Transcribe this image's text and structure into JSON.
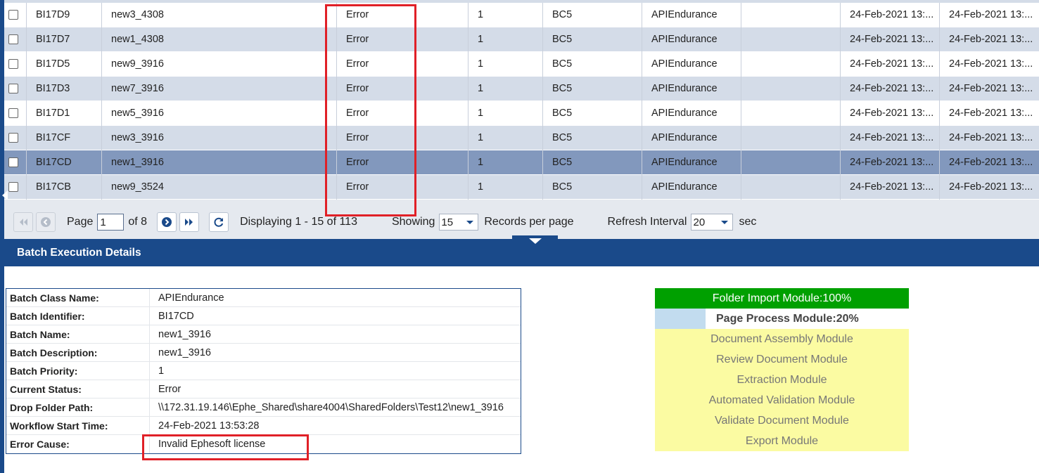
{
  "grid": {
    "rows": [
      {
        "id": "BI17D9",
        "name": "new3_4308",
        "status": "Error",
        "priority": "1",
        "batch_class": "BC5",
        "class_desc": "APIEndurance",
        "extra": "",
        "date1": "24-Feb-2021 13:...",
        "date2": "24-Feb-2021 13:...",
        "selected": false
      },
      {
        "id": "BI17D7",
        "name": "new1_4308",
        "status": "Error",
        "priority": "1",
        "batch_class": "BC5",
        "class_desc": "APIEndurance",
        "extra": "",
        "date1": "24-Feb-2021 13:...",
        "date2": "24-Feb-2021 13:...",
        "selected": false
      },
      {
        "id": "BI17D5",
        "name": "new9_3916",
        "status": "Error",
        "priority": "1",
        "batch_class": "BC5",
        "class_desc": "APIEndurance",
        "extra": "",
        "date1": "24-Feb-2021 13:...",
        "date2": "24-Feb-2021 13:...",
        "selected": false
      },
      {
        "id": "BI17D3",
        "name": "new7_3916",
        "status": "Error",
        "priority": "1",
        "batch_class": "BC5",
        "class_desc": "APIEndurance",
        "extra": "",
        "date1": "24-Feb-2021 13:...",
        "date2": "24-Feb-2021 13:...",
        "selected": false
      },
      {
        "id": "BI17D1",
        "name": "new5_3916",
        "status": "Error",
        "priority": "1",
        "batch_class": "BC5",
        "class_desc": "APIEndurance",
        "extra": "",
        "date1": "24-Feb-2021 13:...",
        "date2": "24-Feb-2021 13:...",
        "selected": false
      },
      {
        "id": "BI17CF",
        "name": "new3_3916",
        "status": "Error",
        "priority": "1",
        "batch_class": "BC5",
        "class_desc": "APIEndurance",
        "extra": "",
        "date1": "24-Feb-2021 13:...",
        "date2": "24-Feb-2021 13:...",
        "selected": false
      },
      {
        "id": "BI17CD",
        "name": "new1_3916",
        "status": "Error",
        "priority": "1",
        "batch_class": "BC5",
        "class_desc": "APIEndurance",
        "extra": "",
        "date1": "24-Feb-2021 13:...",
        "date2": "24-Feb-2021 13:...",
        "selected": true
      },
      {
        "id": "BI17CB",
        "name": "new9_3524",
        "status": "Error",
        "priority": "1",
        "batch_class": "BC5",
        "class_desc": "APIEndurance",
        "extra": "",
        "date1": "24-Feb-2021 13:...",
        "date2": "24-Feb-2021 13:...",
        "selected": false
      }
    ]
  },
  "pager": {
    "page_label": "Page",
    "page_value": "1",
    "of_label": "of 8",
    "displaying": "Displaying 1 - 15 of 113",
    "showing_label": "Showing",
    "showing_value": "15",
    "records_label": "Records per page",
    "refresh_label": "Refresh Interval",
    "refresh_value": "20",
    "sec_label": "sec"
  },
  "section": {
    "title": "Batch Execution Details"
  },
  "details": [
    {
      "label": "Batch Class Name:",
      "value": "APIEndurance"
    },
    {
      "label": "Batch Identifier:",
      "value": "BI17CD"
    },
    {
      "label": "Batch Name:",
      "value": "new1_3916"
    },
    {
      "label": "Batch Description:",
      "value": "new1_3916"
    },
    {
      "label": "Batch Priority:",
      "value": "1"
    },
    {
      "label": "Current Status:",
      "value": "Error"
    },
    {
      "label": "Drop Folder Path:",
      "value": "\\\\172.31.19.146\\Ephe_Shared\\share4004\\SharedFolders\\Test12\\new1_3916"
    },
    {
      "label": "Workflow Start Time:",
      "value": "24-Feb-2021 13:53:28"
    },
    {
      "label": "Error Cause:",
      "value": "Invalid Ephesoft license"
    }
  ],
  "modules": [
    {
      "label": "Folder Import Module:100%",
      "state": "done",
      "progress": 1.0
    },
    {
      "label": "Page Process Module:20%",
      "state": "partial",
      "progress": 0.2
    },
    {
      "label": "Document Assembly Module",
      "state": "pending"
    },
    {
      "label": "Review Document Module",
      "state": "pending"
    },
    {
      "label": "Extraction Module",
      "state": "pending"
    },
    {
      "label": "Automated Validation Module",
      "state": "pending"
    },
    {
      "label": "Validate Document Module",
      "state": "pending"
    },
    {
      "label": "Export Module",
      "state": "pending"
    }
  ],
  "colors": {
    "header_blue": "#1a4a8a",
    "row_alt": "#d4dce8",
    "row_selected": "#8298bd",
    "module_done": "#00a000",
    "module_pending": "#fbfba2",
    "module_partial_fill": "#c2dcef",
    "highlight": "#e02027"
  }
}
